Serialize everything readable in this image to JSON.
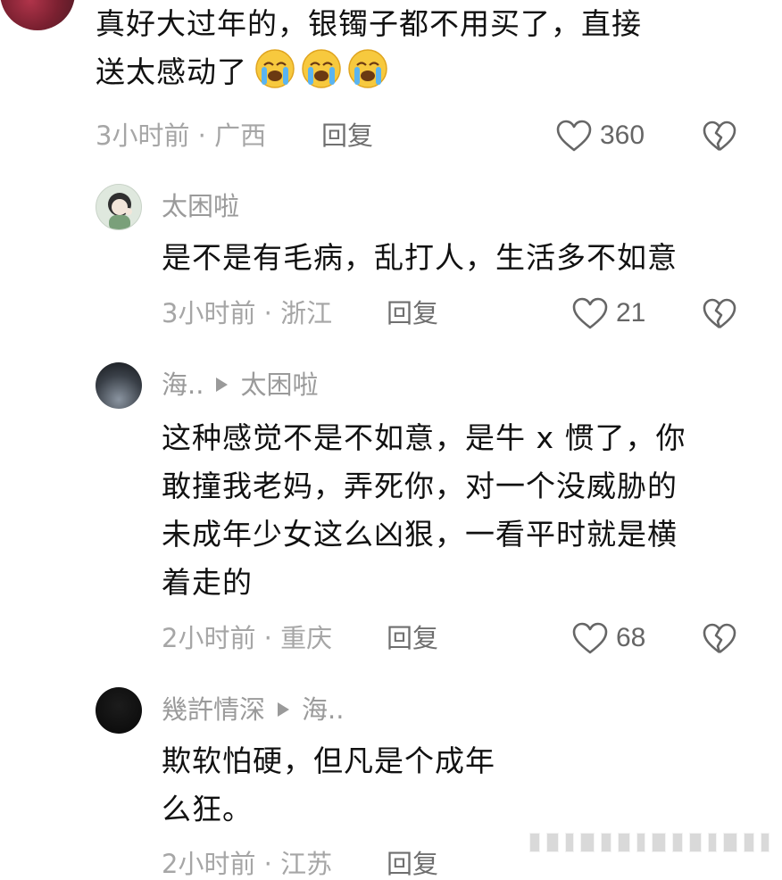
{
  "comments": [
    {
      "text_lines": [
        "真好大过年的，银镯子都不用买了，直接",
        "送太感动了"
      ],
      "emoji": "loudly-crying-face",
      "emoji_count": 3,
      "time": "3小时前 · 广西",
      "reply_label": "回复",
      "likes": "360"
    },
    {
      "user": "太困啦",
      "text_lines": [
        "是不是有毛病，乱打人，生活多不如意"
      ],
      "time": "3小时前 · 浙江",
      "reply_label": "回复",
      "likes": "21"
    },
    {
      "user": "海..",
      "reply_to": "太困啦",
      "text_lines": [
        "这种感觉不是不如意，是牛 x 惯了，你",
        "敢撞我老妈，弄死你，对一个没威胁的",
        "未成年少女这么凶狠，一看平时就是横",
        "着走的"
      ],
      "time": "2小时前 · 重庆",
      "reply_label": "回复",
      "likes": "68"
    },
    {
      "user": "幾許情深",
      "reply_to": "海..",
      "text_lines": [
        "欺软怕硬，但凡是个成年",
        "么狂。"
      ],
      "time": "2小时前 · 江苏",
      "reply_label": "回复"
    }
  ],
  "icons": {
    "like": "heart-outline-icon",
    "dislike": "broken-heart-icon"
  },
  "colors": {
    "text": "#111111",
    "meta": "#a6a6a6",
    "username": "#9a9a9a"
  }
}
